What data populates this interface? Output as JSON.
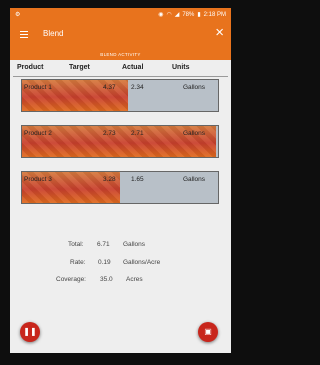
{
  "status": {
    "left_icon": "settings-icon",
    "battery": "78%",
    "time": "2:18 PM"
  },
  "app": {
    "title": "Blend",
    "close_icon": "×"
  },
  "subheader": "BLEND ACTIVITY",
  "columns": [
    "Product",
    "Target",
    "Actual",
    "Units"
  ],
  "rows": [
    {
      "product": "Product 1",
      "target": "4.37",
      "actual": "2.34",
      "units": "Gallons",
      "progress": 0.54
    },
    {
      "product": "Product 2",
      "target": "2.73",
      "actual": "2.71",
      "units": "Gallons",
      "progress": 0.99
    },
    {
      "product": "Product 3",
      "target": "3.28",
      "actual": "1.65",
      "units": "Gallons",
      "progress": 0.5
    }
  ],
  "summary": {
    "total_label": "Total:",
    "total_value": "6.71",
    "total_unit": "Gallons",
    "rate_label": "Rate:",
    "rate_value": "0.19",
    "rate_unit": "Gallons/Acre",
    "coverage_label": "Coverage:",
    "coverage_value": "35.0",
    "coverage_unit": "Acres"
  },
  "buttons": {
    "pause_icon": "pause-icon",
    "save_icon": "save-icon"
  },
  "colors": {
    "accent": "#e8731d",
    "fab": "#c8261c",
    "progress": "#c9402e"
  }
}
